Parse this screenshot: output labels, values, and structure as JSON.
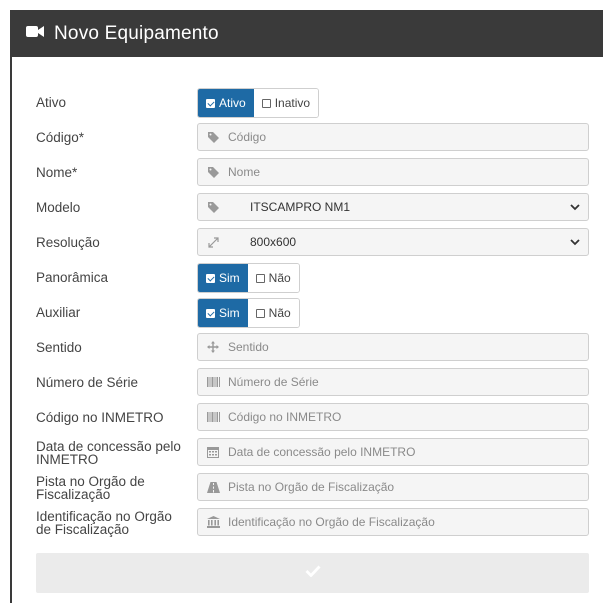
{
  "header": {
    "title": "Novo Equipamento",
    "icon": "video-camera-icon"
  },
  "fields": {
    "ativo": {
      "label": "Ativo",
      "options": [
        "Ativo",
        "Inativo"
      ],
      "selected": "Ativo"
    },
    "codigo": {
      "label": "Código*",
      "placeholder": "Código",
      "icon": "tag-icon"
    },
    "nome": {
      "label": "Nome*",
      "placeholder": "Nome",
      "icon": "tag-icon"
    },
    "modelo": {
      "label": "Modelo",
      "value": "ITSCAMPRO NM1",
      "icon": "tag-icon"
    },
    "resolucao": {
      "label": "Resolução",
      "value": "800x600",
      "icon": "expand-icon"
    },
    "panoramica": {
      "label": "Panorâmica",
      "options": [
        "Sim",
        "Não"
      ],
      "selected": "Sim"
    },
    "auxiliar": {
      "label": "Auxiliar",
      "options": [
        "Sim",
        "Não"
      ],
      "selected": "Sim"
    },
    "sentido": {
      "label": "Sentido",
      "placeholder": "Sentido",
      "icon": "arrows-icon"
    },
    "numero_serie": {
      "label": "Número de Série",
      "placeholder": "Número de Série",
      "icon": "barcode-icon"
    },
    "codigo_inmetro": {
      "label": "Código no INMETRO",
      "placeholder": "Código no INMETRO",
      "icon": "barcode-icon"
    },
    "data_concessao": {
      "label_line1": "Data de concessão pelo",
      "label_line2": "INMETRO",
      "placeholder": "Data de concessão pelo INMETRO",
      "icon": "calendar-icon"
    },
    "pista": {
      "label_line1": "Pista no Orgão de",
      "label_line2": "Fiscalização",
      "placeholder": "Pista no Orgão de Fiscalização",
      "icon": "road-icon"
    },
    "identificacao": {
      "label_line1": "Identificação no Orgão",
      "label_line2": "de Fiscalização",
      "placeholder": "Identificação no Orgão de Fiscalização",
      "icon": "institution-icon"
    }
  },
  "submit": {
    "icon": "check-icon"
  }
}
